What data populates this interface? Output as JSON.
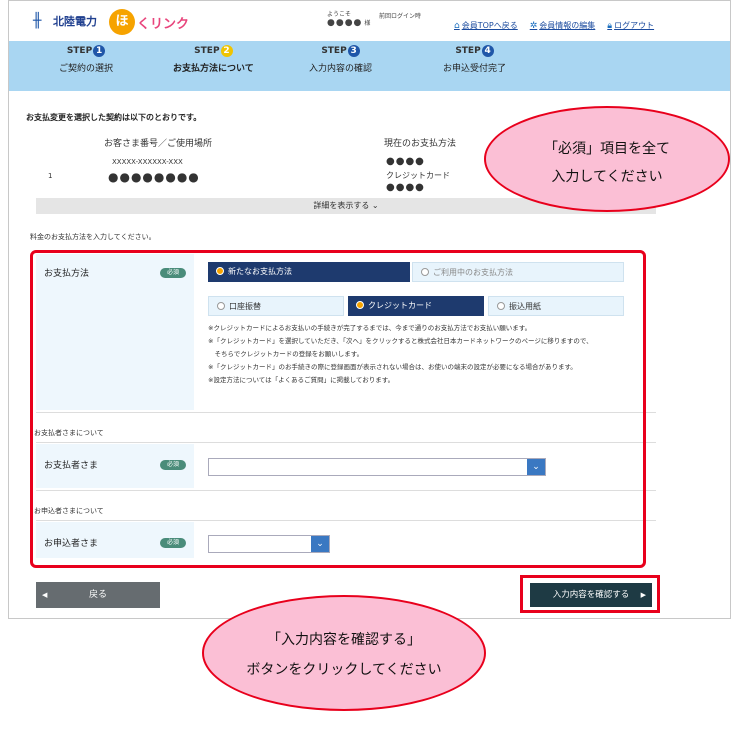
{
  "header": {
    "brand_name": "北陸電力",
    "hoku_char": "ほ",
    "hoku_text": "くリンク",
    "welcome_label": "ようこそ",
    "user_name": "●●●●",
    "user_suffix": "様",
    "last_login_label": "前回ログイン時",
    "links": [
      {
        "label": "会員TOPへ戻る",
        "icon": "home-icon"
      },
      {
        "label": "会員情報の編集",
        "icon": "gear-icon"
      },
      {
        "label": "ログアウト",
        "icon": "lock-icon"
      }
    ]
  },
  "steps": [
    {
      "step": "STEP",
      "num": "1",
      "label": "ご契約の選択"
    },
    {
      "step": "STEP",
      "num": "2",
      "label": "お支払方法について"
    },
    {
      "step": "STEP",
      "num": "3",
      "label": "入力内容の確認"
    },
    {
      "step": "STEP",
      "num": "4",
      "label": "お申込受付完了"
    }
  ],
  "contract": {
    "section_title": "お支払変更を選択した契約は以下のとおりです。",
    "col_customer": "お客さま番号／ご使用場所",
    "col_payment": "現在のお支払方法",
    "row_no": "1",
    "customer_no": "XXXXX-XXXXXX-XXX",
    "customer_place": "●●●●●●●●",
    "payment_masked1": "●●●●",
    "payment_method": "クレジットカード",
    "payment_masked2": "●●●●",
    "detail_toggle": "詳細を表示する ⌄"
  },
  "form": {
    "instruction": "料金のお支払方法を入力してください。",
    "payment_label": "お支払方法",
    "required_badge": "必須",
    "tab_new": "新たなお支払方法",
    "tab_current": "ご利用中のお支払方法",
    "options": [
      "口座振替",
      "クレジットカード",
      "振込用紙"
    ],
    "notes": [
      "※クレジットカードによるお支払いの手続きが完了するまでは、今まで通りのお支払方法でお支払い願います。",
      "※「クレジットカード」を選択していただき、「次へ」をクリックすると株式会社日本カードネットワークのページに移りますので、",
      "　そちらでクレジットカードの登録をお願いします。",
      "※「クレジットカード」のお手続きの際に登録画面が表示されない場合は、お使いの端末の設定が必要になる場合があります。",
      "※設定方法については「よくあるご質問」に掲載しております。"
    ],
    "payer_section": "お支払者さまについて",
    "payer_label": "お支払者さま",
    "applicant_section": "お申込者さまについて",
    "applicant_label": "お申込者さま"
  },
  "buttons": {
    "back": "戻る",
    "confirm": "入力内容を確認する"
  },
  "callouts": {
    "c1_line1": "「必須」項目を全て",
    "c1_line2": "入力してください",
    "c2_line1": "「入力内容を確認する」",
    "c2_line2": "ボタンをクリックしてください"
  },
  "colors": {
    "accent": "#1e3a6e",
    "highlight": "#e8001c",
    "callout": "#fbbfd5"
  }
}
